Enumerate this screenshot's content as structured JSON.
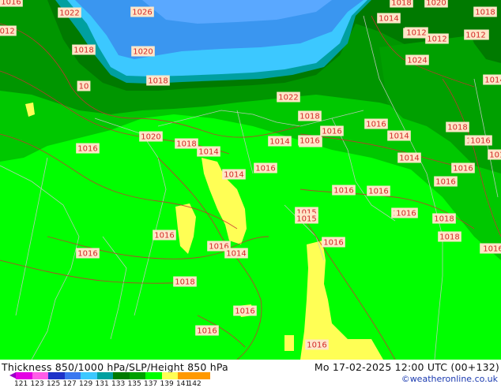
{
  "map": {
    "colors": {
      "fill_121": "#e400e4",
      "fill_123": "#ff5ce8",
      "fill_125": "#1e32c8",
      "fill_127": "#3a78f0",
      "fill_129": "#3cc8ff",
      "fill_131": "#00a0a0",
      "fill_133": "#007a00",
      "fill_135": "#00ff00",
      "fill_137": "#ffff55",
      "isobar": "#c83232",
      "label_bg": "#ffe6c8",
      "label_text": "#d22828",
      "border": "#c8c8c8"
    },
    "pressure_labels": [
      {
        "text": "1016"
      },
      {
        "text": "1022"
      },
      {
        "text": "1026"
      },
      {
        "text": "1018"
      },
      {
        "text": "1020"
      },
      {
        "text": "1018"
      },
      {
        "text": "1014"
      },
      {
        "text": "1018"
      },
      {
        "text": "1012"
      },
      {
        "text": "1018"
      },
      {
        "text": "1012"
      },
      {
        "text": "1018"
      },
      {
        "text": "1020"
      },
      {
        "text": "1024"
      },
      {
        "text": "1014"
      },
      {
        "text": "10"
      },
      {
        "text": "1018"
      },
      {
        "text": "1022"
      },
      {
        "text": "1018"
      },
      {
        "text": "1016"
      },
      {
        "text": "1016"
      },
      {
        "text": "1016"
      },
      {
        "text": "1014"
      },
      {
        "text": "1014"
      },
      {
        "text": "1020"
      },
      {
        "text": "1018"
      },
      {
        "text": "1014"
      },
      {
        "text": "1014"
      },
      {
        "text": "1018"
      },
      {
        "text": "1016"
      },
      {
        "text": "1014"
      },
      {
        "text": "1016"
      },
      {
        "text": "1018"
      },
      {
        "text": "1016"
      },
      {
        "text": "1018"
      },
      {
        "text": "1016"
      },
      {
        "text": "1018"
      },
      {
        "text": "1018"
      },
      {
        "text": "1016"
      },
      {
        "text": "1016"
      },
      {
        "text": "1015"
      },
      {
        "text": "1015"
      },
      {
        "text": "1018"
      },
      {
        "text": "1016"
      },
      {
        "text": "1018"
      },
      {
        "text": "1016"
      },
      {
        "text": "1016"
      },
      {
        "text": "1014"
      },
      {
        "text": "1016"
      },
      {
        "text": "1018"
      },
      {
        "text": "1016"
      },
      {
        "text": "1016"
      },
      {
        "text": "1016"
      },
      {
        "text": "1016"
      },
      {
        "text": "1016"
      },
      {
        "text": "1016"
      },
      {
        "text": "1012"
      },
      {
        "text": "1012"
      },
      {
        "text": "1016"
      }
    ]
  },
  "footer": {
    "title": "Thickness 850/1000 hPa/SLP/Height 850 hPa",
    "valid_time": "Mo 17-02-2025 12:00 UTC (00+132)",
    "credit": "©weatheronline.co.uk"
  },
  "legend": {
    "ticks": [
      "121",
      "123",
      "125",
      "127",
      "129",
      "131",
      "133",
      "135",
      "137",
      "139",
      "141",
      "142"
    ],
    "colors": [
      "#e400e4",
      "#ff5ce8",
      "#1e32c8",
      "#3a78f0",
      "#3cc8ff",
      "#00a0a0",
      "#007a00",
      "#00a000",
      "#00ff00",
      "#ffff55",
      "#ff9900",
      "#ff9900"
    ]
  }
}
